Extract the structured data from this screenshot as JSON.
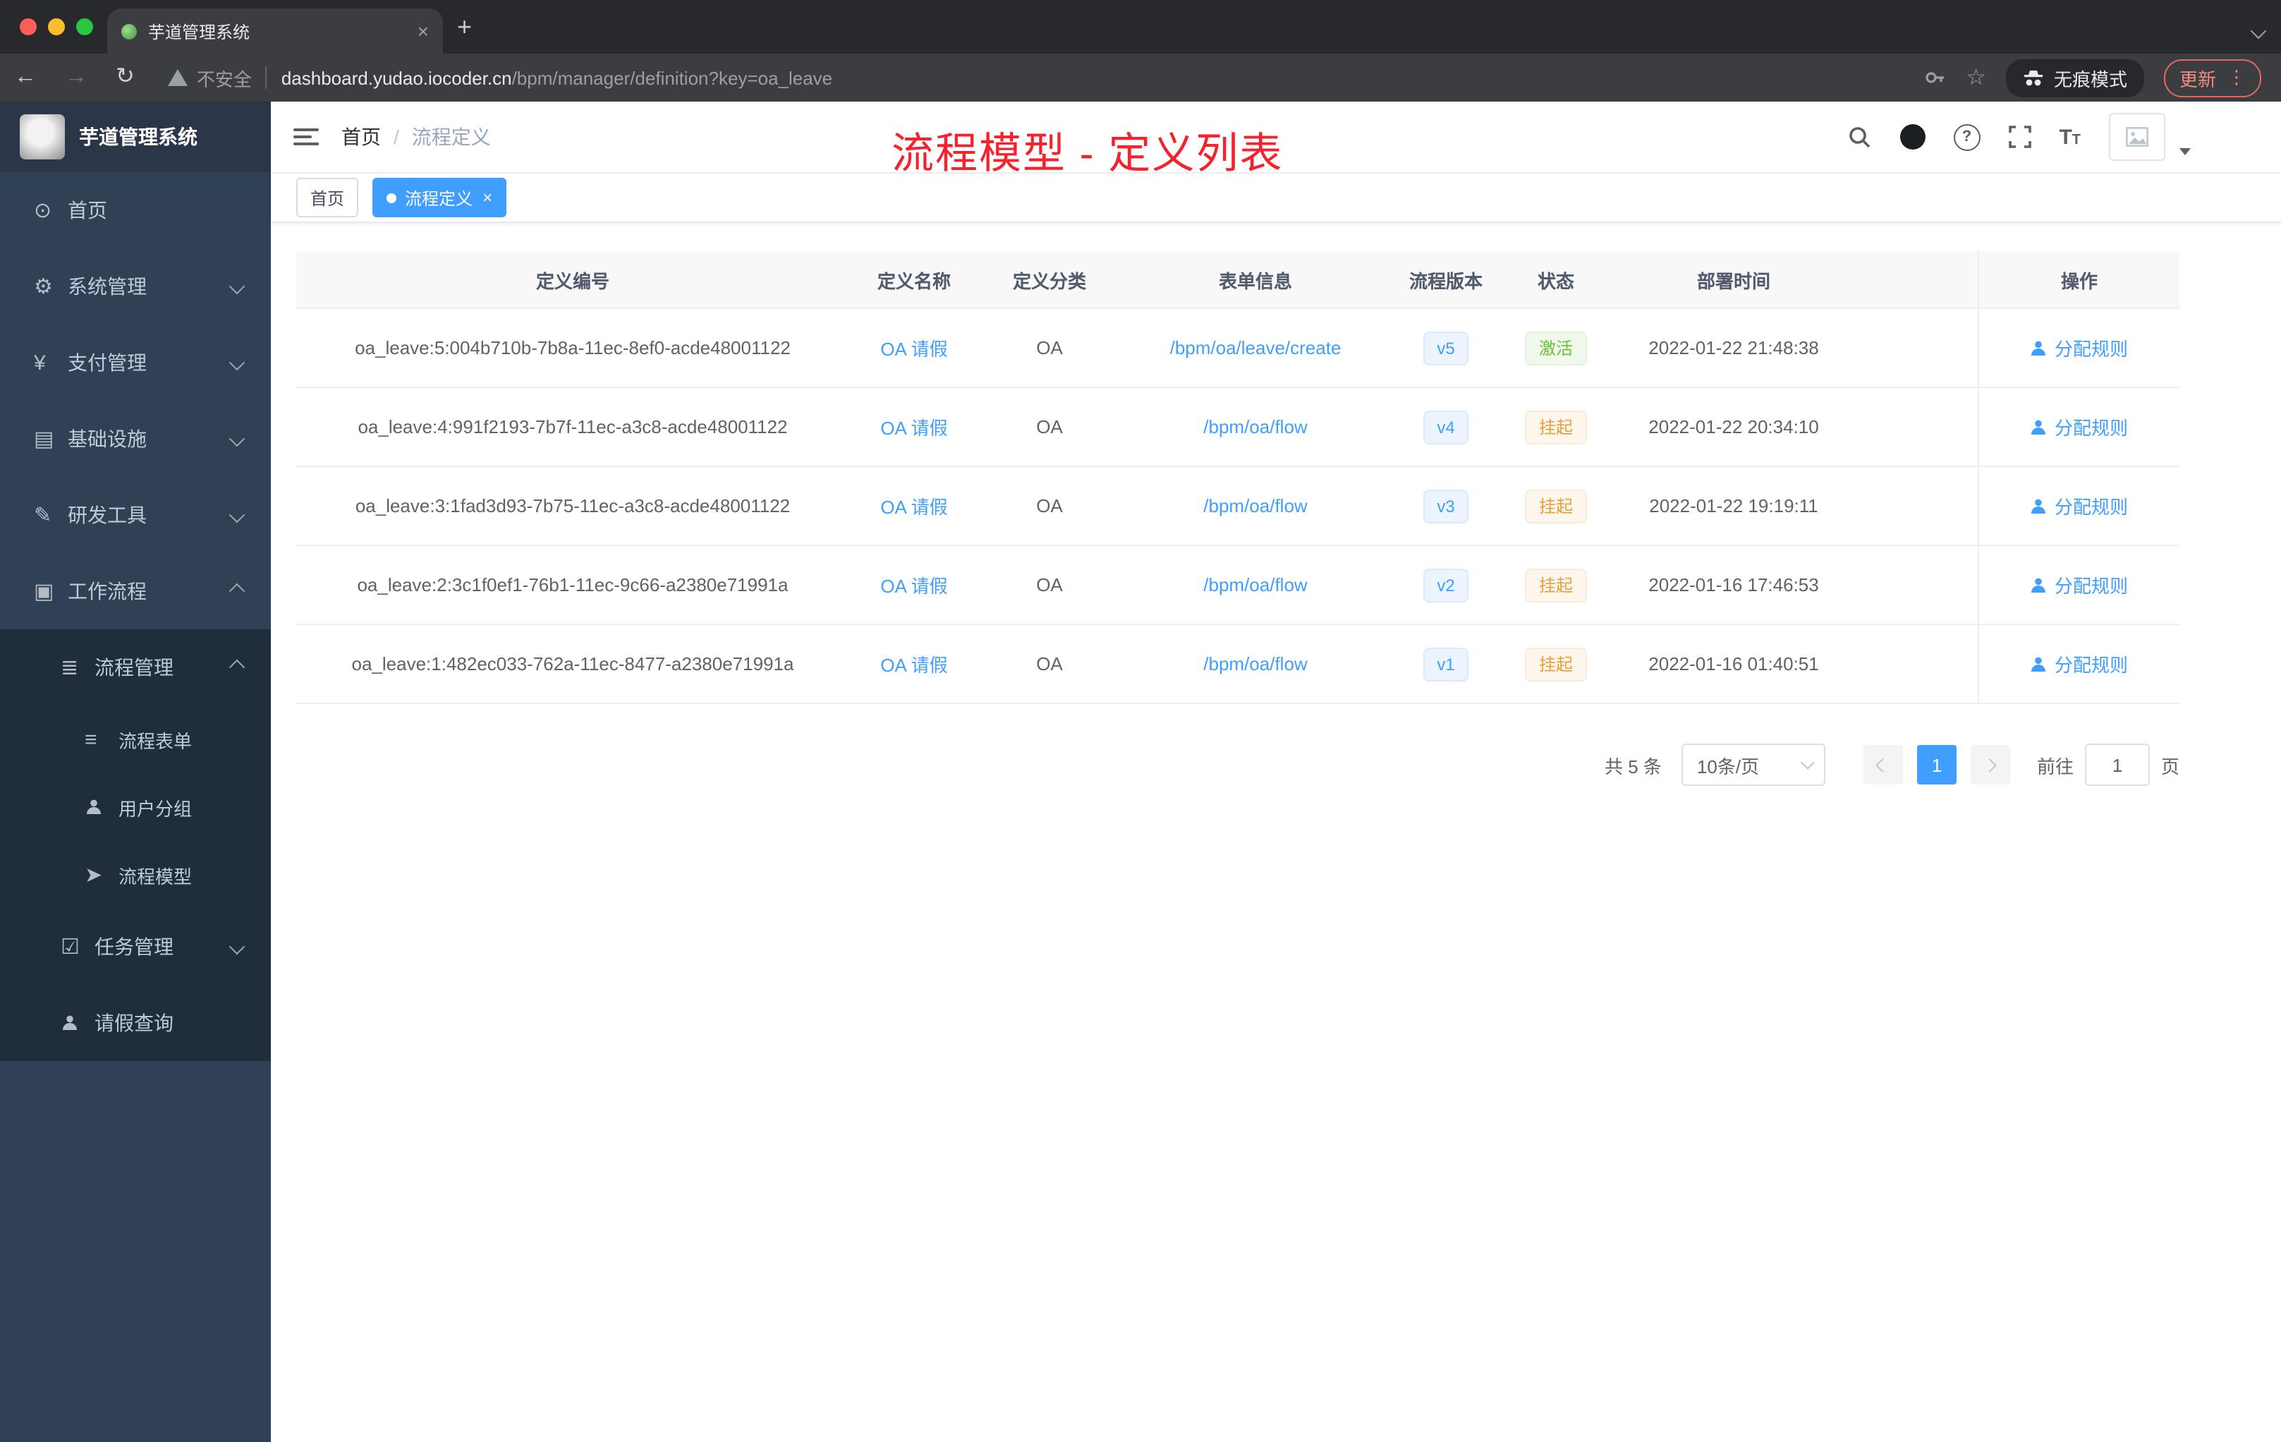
{
  "browser": {
    "tab_title": "芋道管理系统",
    "security_label": "不安全",
    "url_host": "dashboard.yudao.iocoder.cn",
    "url_path": "/bpm/manager/definition?key=oa_leave",
    "incognito_label": "无痕模式",
    "update_label": "更新"
  },
  "sidebar": {
    "logo_title": "芋道管理系统",
    "items": [
      {
        "label": "首页",
        "icon": "dashboard-icon",
        "glyph": "⊙"
      },
      {
        "label": "系统管理",
        "icon": "gear-icon",
        "glyph": "⚙"
      },
      {
        "label": "支付管理",
        "icon": "yen-icon",
        "glyph": "¥"
      },
      {
        "label": "基础设施",
        "icon": "monitor-icon",
        "glyph": "▤"
      },
      {
        "label": "研发工具",
        "icon": "tools-icon",
        "glyph": "✎"
      },
      {
        "label": "工作流程",
        "icon": "briefcase-icon",
        "glyph": "▣"
      },
      {
        "label": "流程管理",
        "icon": "list-icon",
        "glyph": "≣"
      },
      {
        "label": "流程表单",
        "icon": "document-icon",
        "glyph": "≡"
      },
      {
        "label": "用户分组",
        "icon": "user-group-icon",
        "glyph": ""
      },
      {
        "label": "流程模型",
        "icon": "paper-plane-icon",
        "glyph": "➤"
      },
      {
        "label": "任务管理",
        "icon": "task-icon",
        "glyph": "☑"
      },
      {
        "label": "请假查询",
        "icon": "user-icon",
        "glyph": ""
      }
    ]
  },
  "navbar": {
    "breadcrumb_home": "首页",
    "breadcrumb_separator": "/",
    "breadcrumb_current": "流程定义"
  },
  "annotation": "流程模型 - 定义列表",
  "tags": {
    "inactive": "首页",
    "active": "流程定义"
  },
  "table": {
    "columns": [
      "定义编号",
      "定义名称",
      "定义分类",
      "表单信息",
      "流程版本",
      "状态",
      "部署时间",
      "操作"
    ],
    "action_label": "分配规则",
    "rows": [
      {
        "id": "oa_leave:5:004b710b-7b8a-11ec-8ef0-acde48001122",
        "name": "OA 请假",
        "category": "OA",
        "form": "/bpm/oa/leave/create",
        "version": "v5",
        "status": "激活",
        "status_type": "success",
        "deploy_time": "2022-01-22 21:48:38"
      },
      {
        "id": "oa_leave:4:991f2193-7b7f-11ec-a3c8-acde48001122",
        "name": "OA 请假",
        "category": "OA",
        "form": "/bpm/oa/flow",
        "version": "v4",
        "status": "挂起",
        "status_type": "warning",
        "deploy_time": "2022-01-22 20:34:10"
      },
      {
        "id": "oa_leave:3:1fad3d93-7b75-11ec-a3c8-acde48001122",
        "name": "OA 请假",
        "category": "OA",
        "form": "/bpm/oa/flow",
        "version": "v3",
        "status": "挂起",
        "status_type": "warning",
        "deploy_time": "2022-01-22 19:19:11"
      },
      {
        "id": "oa_leave:2:3c1f0ef1-76b1-11ec-9c66-a2380e71991a",
        "name": "OA 请假",
        "category": "OA",
        "form": "/bpm/oa/flow",
        "version": "v2",
        "status": "挂起",
        "status_type": "warning",
        "deploy_time": "2022-01-16 17:46:53"
      },
      {
        "id": "oa_leave:1:482ec033-762a-11ec-8477-a2380e71991a",
        "name": "OA 请假",
        "category": "OA",
        "form": "/bpm/oa/flow",
        "version": "v1",
        "status": "挂起",
        "status_type": "warning",
        "deploy_time": "2022-01-16 01:40:51"
      }
    ]
  },
  "pagination": {
    "total": "共 5 条",
    "page_size": "10条/页",
    "page": "1",
    "goto_label": "前往",
    "goto_value": "1",
    "page_unit": "页"
  },
  "colors": {
    "primary": "#409eff",
    "success": "#67c23a",
    "warning": "#e6a23c",
    "annotation_red": "#f5222d",
    "sidebar_bg": "#304156",
    "submenu_bg": "#1f2d3d"
  }
}
